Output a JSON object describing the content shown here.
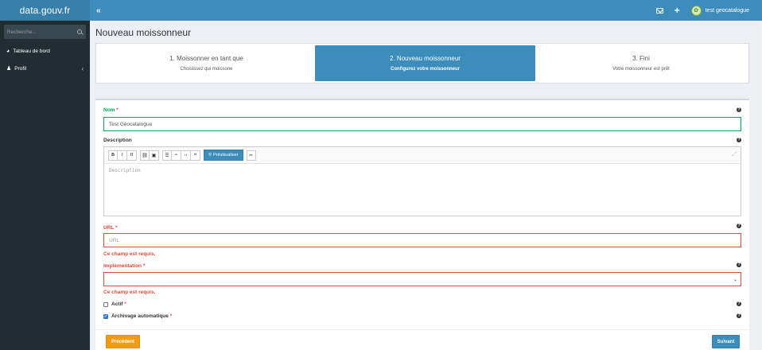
{
  "header": {
    "brand": "data.gouv.fr",
    "toggle_icon": "«",
    "user_name": "test geocatalogue"
  },
  "sidebar": {
    "search_placeholder": "Recherche...",
    "items": [
      {
        "label": "Tableau de bord",
        "icon": "dashboard-icon"
      },
      {
        "label": "Profil",
        "icon": "user-icon",
        "chevron": "‹"
      }
    ]
  },
  "page": {
    "title": "Nouveau moissonneur"
  },
  "wizard": {
    "steps": [
      {
        "title": "1. Moissonner en tant que",
        "subtitle": "Choisissez qui moissone",
        "active": false
      },
      {
        "title": "2. Nouveau moissonneur",
        "subtitle": "Configurez votre moissonneur",
        "active": true
      },
      {
        "title": "3. Fini",
        "subtitle": "Votre moissonneur est prêt",
        "active": false
      }
    ]
  },
  "form": {
    "name_label": "Nom",
    "name_value": "Test Géocatalogue",
    "description_label": "Description",
    "description_placeholder": "Description",
    "toolbar": {
      "bold": "B",
      "italic": "I",
      "heading": "H",
      "preview_label": "Prévisualiser"
    },
    "url_label": "URL",
    "url_placeholder": "URL",
    "url_error": "Ce champ est requis.",
    "implementation_label": "Implémentation",
    "implementation_value": "",
    "implementation_error": "Ce champ est requis.",
    "actif_label": "Actif",
    "actif_checked": false,
    "archive_label": "Archivage automatique",
    "archive_checked": true,
    "required_marker": "*"
  },
  "buttons": {
    "previous": "Précédent",
    "next": "Suivant"
  },
  "colors": {
    "primary": "#3c8dbc",
    "brand_dark": "#367fa9",
    "sidebar": "#222d32",
    "success": "#00a65a",
    "danger": "#dd4b39",
    "warning": "#f39c12"
  }
}
